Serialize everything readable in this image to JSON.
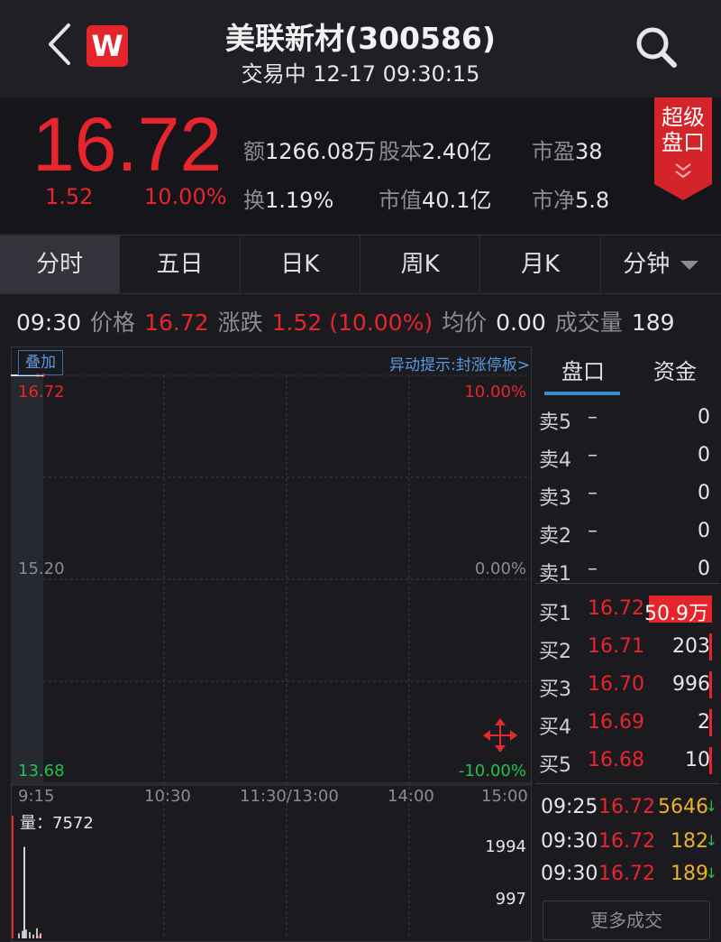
{
  "header": {
    "title": "美联新材(300586)",
    "subtitle": "交易中 12-17 09:30:15",
    "logo_letter": "W"
  },
  "quote": {
    "price": "16.72",
    "change": "1.52",
    "change_pct": "10.00%",
    "stats": [
      {
        "label": "额",
        "value": "1266.08万"
      },
      {
        "label": "股本",
        "value": "2.40亿"
      },
      {
        "label": "市盈",
        "value": "38"
      },
      {
        "label": "换",
        "value": "1.19%"
      },
      {
        "label": "市值",
        "value": "40.1亿"
      },
      {
        "label": "市净",
        "value": "5.8"
      }
    ],
    "super_badge": "超级盘口"
  },
  "tabs": [
    {
      "label": "分时"
    },
    {
      "label": "五日"
    },
    {
      "label": "日K"
    },
    {
      "label": "周K"
    },
    {
      "label": "月K"
    },
    {
      "label": "分钟"
    }
  ],
  "info_line": {
    "time": "09:30",
    "price_label": "价格",
    "price": "16.72",
    "change_label": "涨跌",
    "change": "1.52 (10.00%)",
    "avg_label": "均价",
    "avg": "0.00",
    "volume_label": "成交量",
    "volume": "189"
  },
  "chart": {
    "overlay_label": "叠加",
    "alert_text": "异动提示:封涨停板>",
    "y_left": [
      "16.72",
      "15.20",
      "13.68"
    ],
    "y_right": [
      "10.00%",
      "0.00%",
      "-10.00%"
    ],
    "x_ticks": [
      "9:15",
      "10:30",
      "11:30/13:00",
      "14:00",
      "15:00"
    ],
    "volume_label": "量：7572",
    "vol_ticks": [
      "1994",
      "997"
    ]
  },
  "chart_data": {
    "type": "line",
    "title": "",
    "x_range": [
      "9:15",
      "15:00"
    ],
    "y_range": [
      13.68,
      16.72
    ],
    "pct_range": [
      -10.0,
      10.0
    ],
    "series": [
      {
        "x": [
          "09:25",
          "09:30"
        ],
        "values": [
          16.72,
          16.72
        ]
      }
    ],
    "volume_series": {
      "x": [
        "09:25",
        "09:30"
      ],
      "values": [
        5646,
        189
      ]
    }
  },
  "side_panel": {
    "tabs": [
      "盘口",
      "资金"
    ],
    "asks": [
      {
        "label": "卖5",
        "price": "–",
        "volume": "0"
      },
      {
        "label": "卖4",
        "price": "–",
        "volume": "0"
      },
      {
        "label": "卖3",
        "price": "–",
        "volume": "0"
      },
      {
        "label": "卖2",
        "price": "–",
        "volume": "0"
      },
      {
        "label": "卖1",
        "price": "–",
        "volume": "0"
      }
    ],
    "bids": [
      {
        "label": "买1",
        "price": "16.72",
        "volume": "50.9万"
      },
      {
        "label": "买2",
        "price": "16.71",
        "volume": "203"
      },
      {
        "label": "买3",
        "price": "16.70",
        "volume": "996"
      },
      {
        "label": "买4",
        "price": "16.69",
        "volume": "2"
      },
      {
        "label": "买5",
        "price": "16.68",
        "volume": "10"
      }
    ],
    "trades": [
      {
        "time": "09:25",
        "price": "16.72",
        "volume": "5646"
      },
      {
        "time": "09:30",
        "price": "16.72",
        "volume": "182"
      },
      {
        "time": "09:30",
        "price": "16.72",
        "volume": "189"
      }
    ],
    "more_trades": "更多成交"
  },
  "colors": {
    "up": "#e8252c",
    "down": "#22c24a",
    "accent": "#3a8fd6",
    "volume_text": "#e8b12a"
  }
}
